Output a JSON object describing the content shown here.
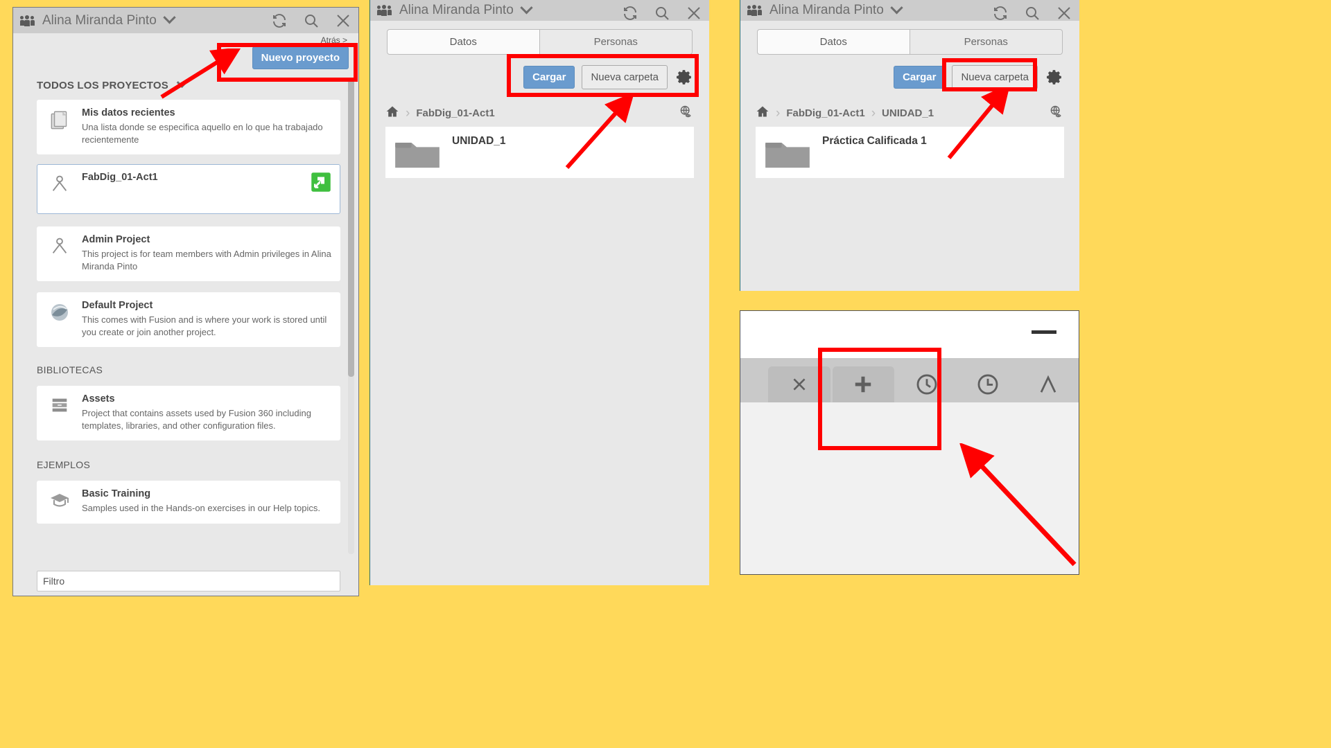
{
  "theme": {
    "background_yellow": "#FFD95A",
    "panel_gray": "#e8e8e8",
    "titlebar_gray": "#cccccc",
    "accent_blue": "#6a9bce",
    "annotation_red": "#FF0000",
    "folder_gray": "#999999",
    "green_badge": "#3fbf3f"
  },
  "left_panel": {
    "titlebar": {
      "team_icon": "people-icon",
      "title": "Alina Miranda Pinto",
      "dropdown_icon": "chevron-down-icon",
      "actions": [
        {
          "name": "refresh-icon",
          "label": "refresh"
        },
        {
          "name": "search-icon",
          "label": "search"
        },
        {
          "name": "close-icon",
          "label": "close"
        }
      ]
    },
    "back_link": "Atrás >",
    "new_project_button": "Nuevo proyecto",
    "sections": [
      {
        "heading": "TODOS LOS PROYECTOS",
        "has_caret": true
      },
      {
        "heading": "BIBLIOTECAS",
        "has_caret": false
      },
      {
        "heading": "EJEMPLOS",
        "has_caret": false
      }
    ],
    "projects": [
      {
        "icon": "documents-icon",
        "title": "Mis datos recientes",
        "desc": "Una lista donde se especifica aquello en lo que ha trabajado recientemente",
        "selected": false,
        "badge": null
      },
      {
        "icon": "project-person-icon",
        "title": "FabDig_01-Act1",
        "desc": "",
        "selected": true,
        "badge": "green-arrow-badge"
      },
      {
        "icon": "project-person-icon",
        "title": "Admin Project",
        "desc": "This project is for team members with Admin privileges in Alina Miranda Pinto",
        "selected": false,
        "badge": null
      },
      {
        "icon": "fusion-sphere-icon",
        "title": "Default Project",
        "desc": "This comes with Fusion and is where your work is stored until you create or join another project.",
        "selected": false,
        "badge": null
      }
    ],
    "libraries": [
      {
        "icon": "library-drawer-icon",
        "title": "Assets",
        "desc": "Project that contains assets used by Fusion 360 including templates, libraries, and other configuration files."
      }
    ],
    "examples": [
      {
        "icon": "graduation-cap-icon",
        "title": "Basic Training",
        "desc": "Samples used in the Hands-on exercises in our Help topics."
      }
    ],
    "filter_label": "Filtro"
  },
  "middle_panel": {
    "titlebar": {
      "title": "Alina Miranda Pinto",
      "dropdown_icon": "chevron-down-icon",
      "actions": [
        {
          "name": "refresh-icon",
          "label": "refresh"
        },
        {
          "name": "search-icon",
          "label": "search"
        },
        {
          "name": "close-icon",
          "label": "close"
        }
      ]
    },
    "tabs": [
      {
        "label": "Datos",
        "active": true
      },
      {
        "label": "Personas",
        "active": false
      }
    ],
    "toolbar": {
      "upload_button": "Cargar",
      "new_folder_button": "Nueva carpeta",
      "settings_icon": "gear-icon"
    },
    "breadcrumb": {
      "home_icon": "home-icon",
      "items": [
        "FabDig_01-Act1"
      ],
      "separator": "›",
      "right_icon": "globe-eye-icon"
    },
    "items": [
      {
        "icon": "folder-icon",
        "name": "UNIDAD_1"
      }
    ]
  },
  "right_panel": {
    "titlebar": {
      "title": "Alina Miranda Pinto",
      "dropdown_icon": "chevron-down-icon",
      "actions": [
        {
          "name": "refresh-icon",
          "label": "refresh"
        },
        {
          "name": "search-icon",
          "label": "search"
        },
        {
          "name": "close-icon",
          "label": "close"
        }
      ]
    },
    "tabs": [
      {
        "label": "Datos",
        "active": true
      },
      {
        "label": "Personas",
        "active": false
      }
    ],
    "toolbar": {
      "upload_button": "Cargar",
      "new_folder_button": "Nueva carpeta",
      "settings_icon": "gear-icon"
    },
    "breadcrumb": {
      "home_icon": "home-icon",
      "items": [
        "FabDig_01-Act1",
        "UNIDAD_1"
      ],
      "separator": "›",
      "right_icon": "globe-eye-icon"
    },
    "items": [
      {
        "icon": "folder-icon",
        "name": "Práctica Calificada 1"
      }
    ]
  },
  "app_window": {
    "minimize_icon": "minimize-icon",
    "tabs": [
      {
        "icon": "close-x-icon",
        "name": "close-tab"
      },
      {
        "icon": "plus-icon",
        "name": "new-tab"
      }
    ],
    "toolbar_icons": [
      {
        "icon": "history-clock-icon",
        "name": "history"
      },
      {
        "icon": "clock-icon",
        "name": "timeline"
      },
      {
        "icon": "person-a-icon",
        "name": "account"
      }
    ]
  },
  "annotations": {
    "boxes": [
      {
        "name": "highlight-new-project",
        "target": "Nuevo proyecto"
      },
      {
        "name": "highlight-cargar-nueva-carpeta",
        "target": "Cargar / Nueva carpeta / gear"
      },
      {
        "name": "highlight-nueva-carpeta",
        "target": "Nueva carpeta"
      },
      {
        "name": "highlight-plus-tab",
        "target": "+ tab"
      }
    ],
    "arrows": 4,
    "color": "#FF0000"
  }
}
